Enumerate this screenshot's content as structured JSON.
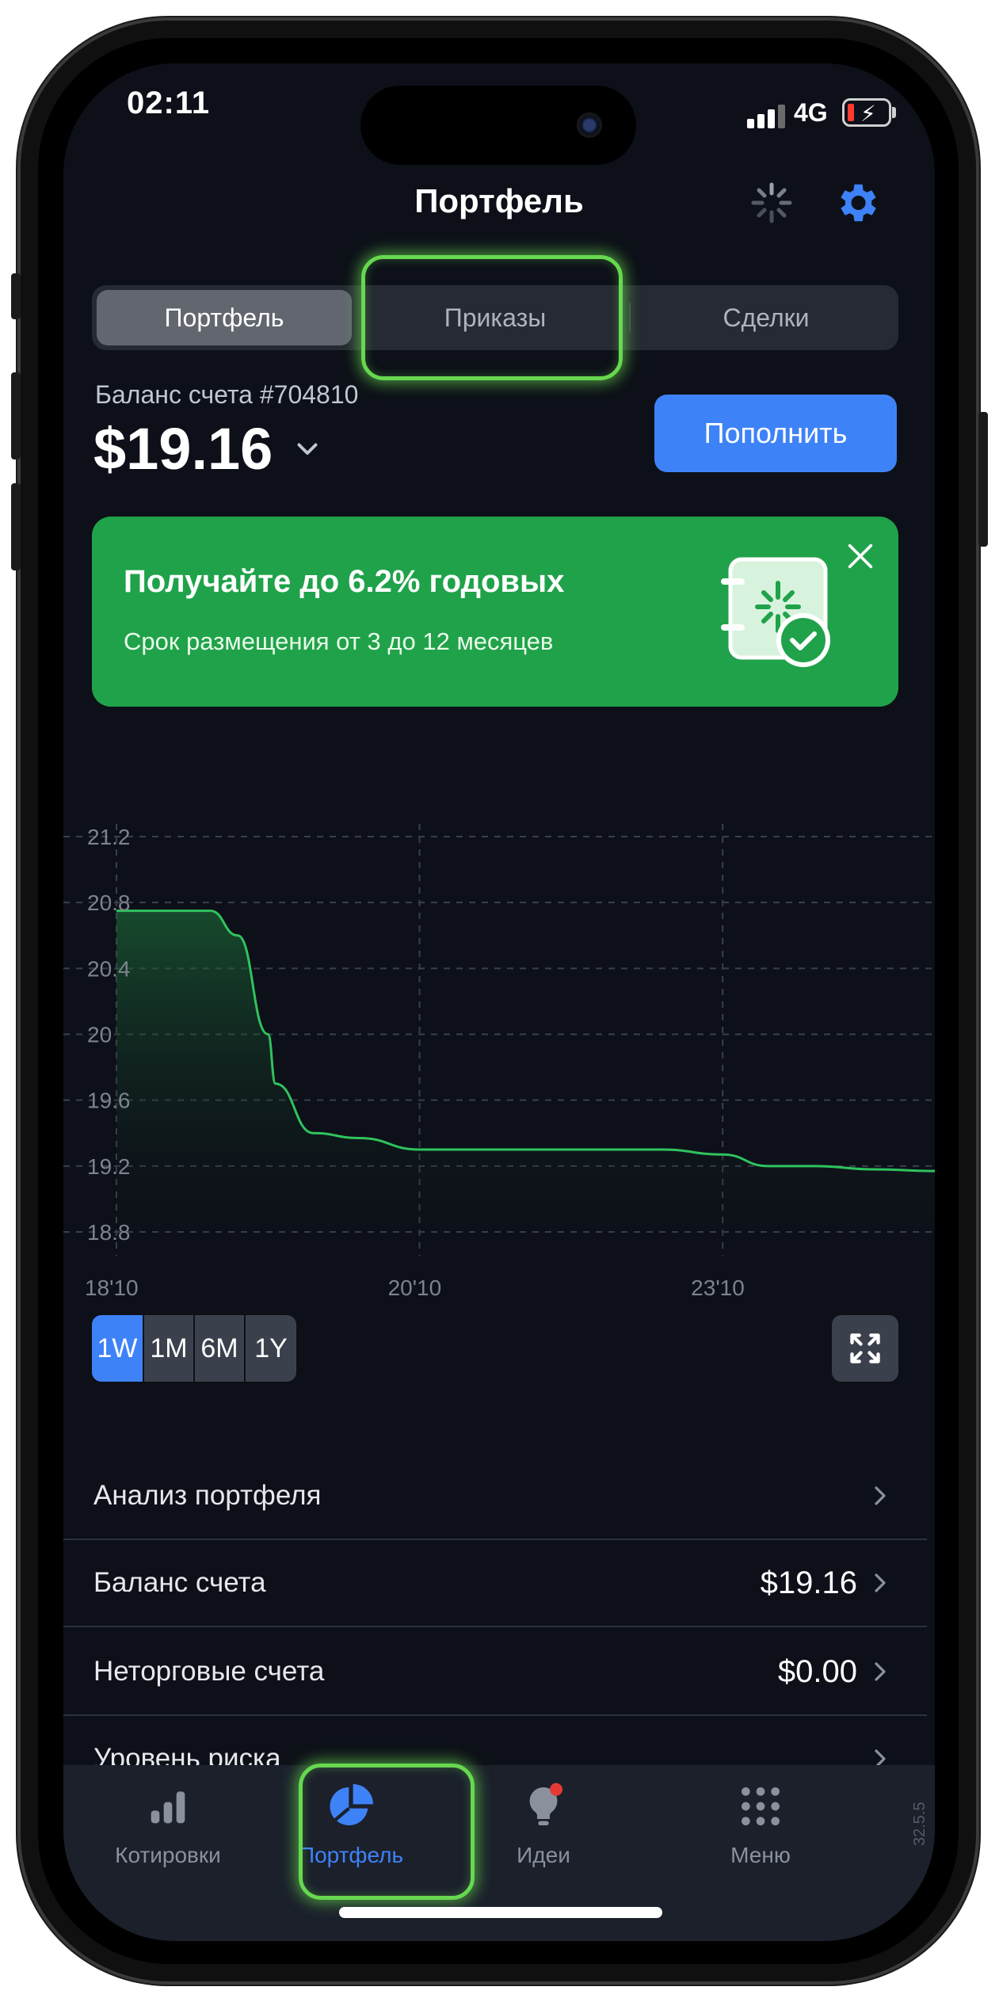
{
  "status_bar": {
    "time": "02:11",
    "network": "4G"
  },
  "header": {
    "title": "Портфель"
  },
  "tabs": [
    {
      "label": "Портфель",
      "active": true
    },
    {
      "label": "Приказы",
      "active": false
    },
    {
      "label": "Сделки",
      "active": false
    }
  ],
  "balance": {
    "label": "Баланс счета #704810",
    "amount": "$19.16",
    "topup_label": "Пополнить"
  },
  "promo": {
    "title": "Получайте до 6.2% годовых",
    "subtitle": "Срок размещения от 3 до 12 месяцев",
    "bg_color": "#20a24a"
  },
  "chart_data": {
    "type": "area",
    "y_ticks": [
      "21.2",
      "20.8",
      "20.4",
      "20",
      "19.6",
      "19.2",
      "18.8"
    ],
    "x_ticks": [
      "18'10",
      "20'10",
      "23'10"
    ],
    "ylim": [
      18.8,
      21.2
    ],
    "x": [
      0,
      0.45,
      0.62,
      0.8,
      1.0,
      1.05,
      1.3,
      1.6,
      2.0,
      2.5,
      3.0,
      3.35,
      3.6,
      4.0,
      4.3,
      4.6,
      5.0,
      5.4
    ],
    "values": [
      20.75,
      20.75,
      20.75,
      20.6,
      20.0,
      19.7,
      19.4,
      19.37,
      19.3,
      19.3,
      19.3,
      19.3,
      19.3,
      19.27,
      19.2,
      19.2,
      19.18,
      19.17
    ],
    "xlim": [
      -0.35,
      5.4
    ],
    "grid": true,
    "line_color": "#2fc35e"
  },
  "periods": [
    {
      "label": "1W",
      "active": true
    },
    {
      "label": "1M",
      "active": false
    },
    {
      "label": "6M",
      "active": false
    },
    {
      "label": "1Y",
      "active": false
    }
  ],
  "list": [
    {
      "label": "Анализ портфеля",
      "value": ""
    },
    {
      "label": "Баланс счета",
      "value": "$19.16"
    },
    {
      "label": "Неторговые счета",
      "value": "$0.00"
    },
    {
      "label": "Уровень риска",
      "value": ""
    }
  ],
  "tabbar": [
    {
      "label": "Котировки",
      "icon": "bar-chart-icon",
      "active": false
    },
    {
      "label": "Портфель",
      "icon": "pie-chart-icon",
      "active": true
    },
    {
      "label": "Идеи",
      "icon": "lightbulb-icon",
      "active": false
    },
    {
      "label": "Меню",
      "icon": "grid-menu-icon",
      "active": false
    }
  ],
  "version": "32.5.5",
  "colors": {
    "accent": "#3e82f7",
    "highlight": "#67d84f",
    "background": "#0d1018"
  }
}
